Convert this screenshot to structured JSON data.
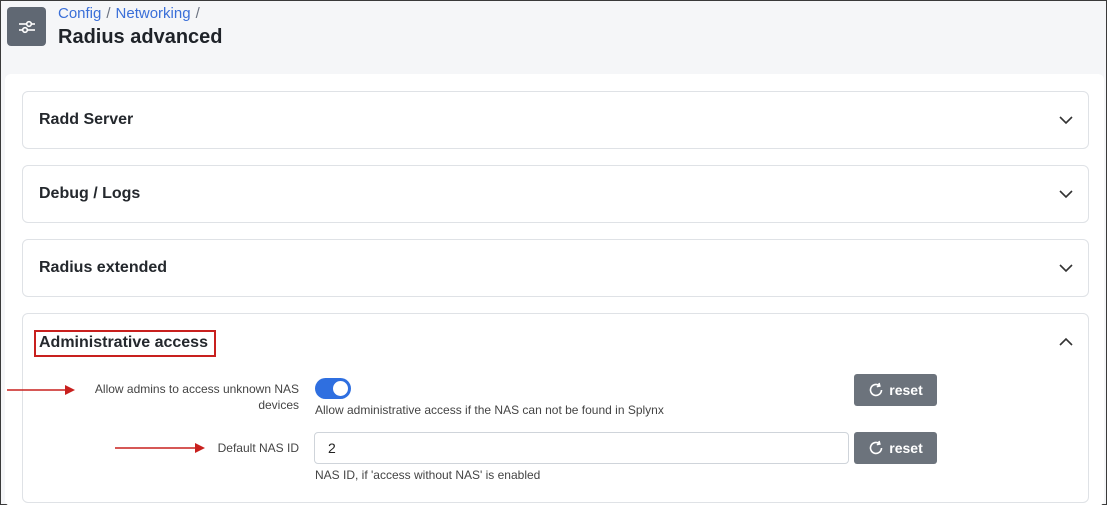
{
  "breadcrumb": {
    "items": [
      "Config",
      "Networking"
    ],
    "separator": "/"
  },
  "page": {
    "title": "Radius advanced",
    "icon": "sliders-icon"
  },
  "panels": [
    {
      "title": "Radd Server",
      "expanded": false
    },
    {
      "title": "Debug / Logs",
      "expanded": false
    },
    {
      "title": "Radius extended",
      "expanded": false
    },
    {
      "title": "Administrative access",
      "expanded": true
    }
  ],
  "admin_access": {
    "allow_unknown_nas": {
      "label_line1": "Allow admins to access unknown NAS",
      "label_line2": "devices",
      "enabled": true,
      "help": "Allow administrative access if the NAS can not be found in Splynx",
      "reset_label": "reset"
    },
    "default_nas_id": {
      "label": "Default NAS ID",
      "value": "2",
      "help": "NAS ID, if 'access without NAS' is enabled",
      "reset_label": "reset"
    }
  },
  "colors": {
    "link": "#3a6fd8",
    "toggle_on": "#2f6fe0",
    "reset_button": "#6c737c",
    "annotation": "#c8201e"
  }
}
